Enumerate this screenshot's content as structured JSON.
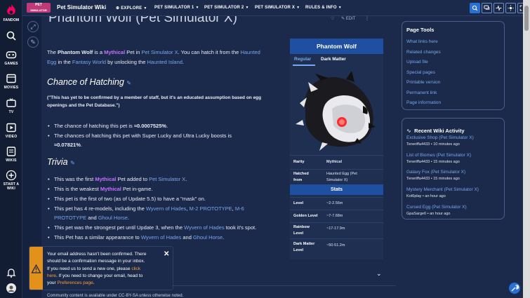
{
  "colors": {
    "accent": "#2a6fd6",
    "mythical": "#c770ff",
    "link": "#79a7ee",
    "warning": "#e2921b"
  },
  "rail": {
    "items": [
      {
        "label": "FANDOM",
        "icon": "fandom-flame-icon"
      },
      {
        "label": "",
        "icon": "search-icon"
      },
      {
        "label": "GAMES",
        "icon": "games-icon"
      },
      {
        "label": "MOVIES",
        "icon": "movies-icon"
      },
      {
        "label": "TV",
        "icon": "tv-icon"
      },
      {
        "label": "VIDEO",
        "icon": "video-icon"
      },
      {
        "label": "WIKIS",
        "icon": "wikis-icon"
      },
      {
        "label": "START A",
        "label2": "WIKI",
        "icon": "plus-icon"
      }
    ]
  },
  "topbar": {
    "brand_line1": "PET",
    "brand_line2": "SIMULATOR",
    "brand_line3": "WIKI",
    "wiki_name": "Pet Simulator Wiki",
    "nav": [
      "EXPLORE",
      "PET SIMULATOR 1",
      "PET SIMULATOR 2",
      "PET SIMULATOR X",
      "RULES & INFO"
    ]
  },
  "article": {
    "title": "Phantom Wolf (Pet Simulator X)",
    "edit_label": "EDIT",
    "intro": {
      "p1": "The ",
      "pet_name": "Phantom Wolf",
      "p2": " is a ",
      "rarity": "Mythical",
      "p3": " Pet in ",
      "link_psx": "Pet Simulator X",
      "p4": ". You can hatch it from the ",
      "link_egg1": "Haunted",
      "link_egg2": "Egg",
      "p5": " in the ",
      "link_fantasy": "Fantasy World",
      "p6": " by unlocking the ",
      "link_island": "Haunted Island",
      "p7": "."
    },
    "h_chance": "Chance of Hatching",
    "note_line1": "(\"This has yet to be confirmed by a member of staff, but it's an educated assumption based on egg",
    "note_line2": "openings and the Pet Database.\")",
    "chance1_text": "The chance of hatching this pet is ",
    "chance1_val": "≈0.0007525%",
    "chance1_end": ".",
    "chance2_text": "The chances of hatching this pet with Super Lucky and Ultra Lucky boosts is",
    "chance2_val": "≈0.07821%",
    "chance2_end": ".",
    "h_trivia": "Trivia",
    "t1_a": "This was the first ",
    "t1_b": "Mythical",
    "t1_c": " Pet added to ",
    "t1_d": "Pet Simulator X",
    "t1_e": ".",
    "t2_a": "This is the weakest ",
    "t2_b": "Mythical",
    "t2_c": " Pet in-game.",
    "t3": "This pet is the first of two (as of Update 5.5) to have a \"mask\" on.",
    "t4_a": "This pet has 4 re-models, including the ",
    "t4_b": "Wyvern of Hades",
    "t4_c": ", ",
    "t4_d": "M-2 PROTOTYPE",
    "t4_e": ", ",
    "t4_f": "M-6",
    "t4_g": "PROTOTYPE",
    "t4_h": " and ",
    "t4_i": "Ghoul Horse",
    "t4_j": ".",
    "t5_a": "This pet was the strongest pet until Update 3, when the ",
    "t5_b": "Wyvern of Hades",
    "t5_c": " took it's spot.",
    "t6_a": "This Pet has a similar appearance to ",
    "t6_b": "Wyvern of Hades",
    "t6_c": " and ",
    "t6_d": "Ghoul Horse",
    "t6_e": ".",
    "footer_text": "Community content is available under CC-BY-SA unless otherwise noted."
  },
  "infobox": {
    "title": "Phantom Wolf",
    "tabs": [
      "Regular",
      "Dark Matter"
    ],
    "active_tab": "Regular",
    "rarity_key": "Rarity",
    "rarity_val": "Mythical",
    "hatched_key1": "Hatched",
    "hatched_key2": "from",
    "hatched_val1": "Haunted Egg (Pet",
    "hatched_val2": "Simulator X)",
    "stats_title": "Stats",
    "stats": [
      {
        "k1": "Level",
        "k2": "",
        "v": "~2-2.56m"
      },
      {
        "k1": "Golden Level",
        "k2": "",
        "v": "~7-7.68m"
      },
      {
        "k1": "Rainbow",
        "k2": "Level",
        "v": "~17-17.9m"
      },
      {
        "k1": "Dark Matter",
        "k2": "Level",
        "v": "~50-51.2m"
      }
    ]
  },
  "page_tools": {
    "title": "Page Tools",
    "links": [
      "What links here",
      "Related changes",
      "Upload file",
      "Special pages",
      "Printable version",
      "Permanent link",
      "Page information"
    ]
  },
  "activity": {
    "title": "Recent Wiki Activity",
    "items": [
      {
        "page": "Exclusive Shop (Pet Simulator X)",
        "user": "Teneriffa4433",
        "time": "10 minutes ago"
      },
      {
        "page": "List of Biomes (Pet Simulator X)",
        "user": "Teneriffa4433",
        "time": "15 minutes ago"
      },
      {
        "page": "Galaxy Fox (Pet Simulator X)",
        "user": "Teneriffa4433",
        "time": "15 minutes ago"
      },
      {
        "page": "Mystery Merchant (Pet Simulator X)",
        "user": "Kot6play",
        "time": "an hour ago"
      },
      {
        "page": "Cursed Egg (Pet Simulator X)",
        "user": "GpaSarge6",
        "time": "an hour ago"
      }
    ]
  },
  "toast": {
    "l1": "Your email address hasn't been confirmed. There",
    "l2": "should be a confirmation message in your inbox.",
    "l3a": "If you need us to send a new one, please ",
    "l3b": "click",
    "l4a": "here",
    "l4b": ". If you need to change your email, head to",
    "l5a": "your ",
    "l5b": "Preferences page",
    "l5c": "."
  }
}
